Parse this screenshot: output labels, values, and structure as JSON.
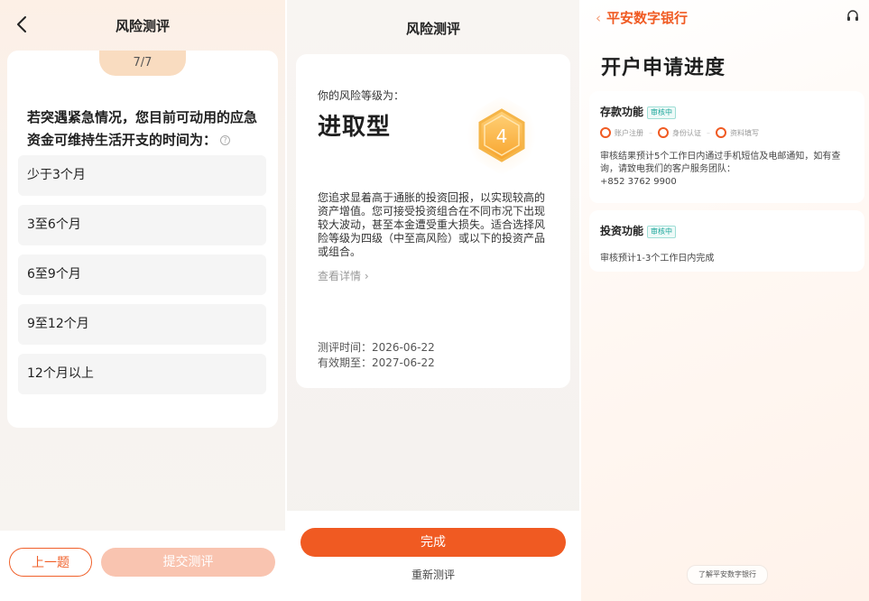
{
  "screen1": {
    "title": "风险测评",
    "progress": "7/7",
    "question": "若突遇紧急情况，您目前可动用的应急资金可维持生活开支的时间为：",
    "options": [
      "少于3个月",
      "3至6个月",
      "6至9个月",
      "9至12个月",
      "12个月以上"
    ],
    "prev_label": "上一题",
    "submit_label": "提交测评"
  },
  "screen2": {
    "title": "风险测评",
    "level_label": "你的风险等级为：",
    "level_name": "进取型",
    "level_number": "4",
    "description": "您追求显着高于通胀的投资回报，以实现较高的资产增值。您可接受投资组合在不同市况下出现较大波动，甚至本金遭受重大损失。适合选择风险等级为四级（中至高风险）或以下的投资产品或组合。",
    "details_link": "查看详情",
    "test_date": "测评时间：2026-06-22",
    "valid_until": "有效期至：2027-06-22",
    "done_label": "完成",
    "retake_label": "重新测评"
  },
  "screen3": {
    "back_glyph": "‹",
    "brand": "平安数字银行",
    "page_title": "开户申请进度",
    "deposit": {
      "title": "存款功能",
      "badge": "审核中",
      "steps": [
        "账户注册",
        "身份认证",
        "资料填写"
      ],
      "body": "审核结果预计5个工作日内通过手机短信及电邮通知，如有查询，请致电我们的客户服务团队：",
      "phone": "+852 3762 9900"
    },
    "invest": {
      "title": "投资功能",
      "badge": "审核中",
      "body": "审核预计1-3个工作日内完成"
    },
    "learn_more": "了解平安数字银行"
  },
  "colors": {
    "accent": "#f05a22",
    "accent_light": "#f9c4b0",
    "badge_teal": "#1aa59a",
    "hex_gold": "#fbb040"
  },
  "icons": [
    "back-arrow-icon",
    "question-help-icon",
    "hexagon-level-icon",
    "chevron-right-icon",
    "headset-icon"
  ]
}
